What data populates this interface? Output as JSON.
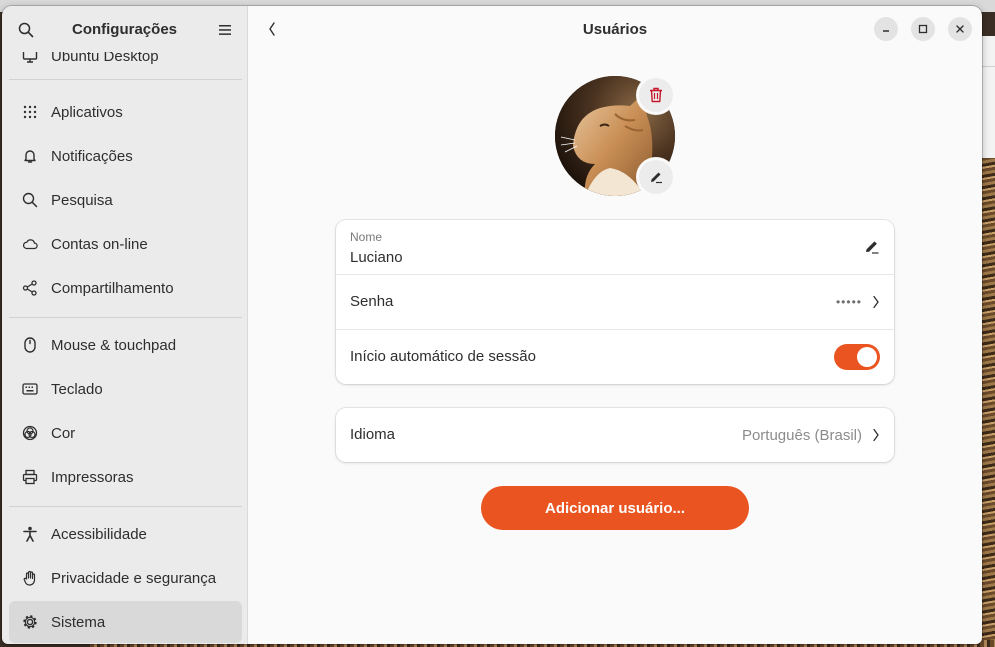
{
  "sidebar": {
    "title": "Configurações",
    "items": [
      {
        "label": "Ubuntu Desktop",
        "icon": "desktop-icon"
      },
      {
        "label": "Aplicativos",
        "icon": "apps-grid-icon"
      },
      {
        "label": "Notificações",
        "icon": "bell-icon"
      },
      {
        "label": "Pesquisa",
        "icon": "search-icon"
      },
      {
        "label": "Contas on-line",
        "icon": "cloud-icon"
      },
      {
        "label": "Compartilhamento",
        "icon": "share-icon"
      },
      {
        "label": "Mouse & touchpad",
        "icon": "mouse-icon"
      },
      {
        "label": "Teclado",
        "icon": "keyboard-icon"
      },
      {
        "label": "Cor",
        "icon": "color-icon"
      },
      {
        "label": "Impressoras",
        "icon": "printer-icon"
      },
      {
        "label": "Acessibilidade",
        "icon": "accessibility-icon"
      },
      {
        "label": "Privacidade e segurança",
        "icon": "hand-icon"
      },
      {
        "label": "Sistema",
        "icon": "gear-icon"
      }
    ],
    "active": "Sistema"
  },
  "main": {
    "title": "Usuários",
    "name_label": "Nome",
    "name_value": "Luciano",
    "password_label": "Senha",
    "password_value": "•••••",
    "autologin_label": "Início automático de sessão",
    "autologin_on": true,
    "language_label": "Idioma",
    "language_value": "Português (Brasil)",
    "add_user_label": "Adicionar usuário..."
  },
  "colors": {
    "accent": "#e95420",
    "delete_icon": "#c7162b"
  }
}
